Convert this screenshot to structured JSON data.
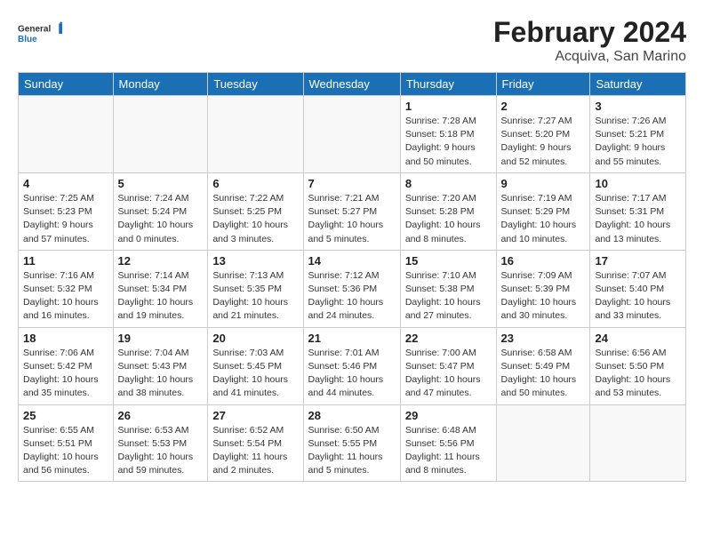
{
  "logo": {
    "general": "General",
    "blue": "Blue"
  },
  "title": "February 2024",
  "subtitle": "Acquiva, San Marino",
  "headers": [
    "Sunday",
    "Monday",
    "Tuesday",
    "Wednesday",
    "Thursday",
    "Friday",
    "Saturday"
  ],
  "weeks": [
    [
      {
        "num": "",
        "info": ""
      },
      {
        "num": "",
        "info": ""
      },
      {
        "num": "",
        "info": ""
      },
      {
        "num": "",
        "info": ""
      },
      {
        "num": "1",
        "info": "Sunrise: 7:28 AM\nSunset: 5:18 PM\nDaylight: 9 hours\nand 50 minutes."
      },
      {
        "num": "2",
        "info": "Sunrise: 7:27 AM\nSunset: 5:20 PM\nDaylight: 9 hours\nand 52 minutes."
      },
      {
        "num": "3",
        "info": "Sunrise: 7:26 AM\nSunset: 5:21 PM\nDaylight: 9 hours\nand 55 minutes."
      }
    ],
    [
      {
        "num": "4",
        "info": "Sunrise: 7:25 AM\nSunset: 5:23 PM\nDaylight: 9 hours\nand 57 minutes."
      },
      {
        "num": "5",
        "info": "Sunrise: 7:24 AM\nSunset: 5:24 PM\nDaylight: 10 hours\nand 0 minutes."
      },
      {
        "num": "6",
        "info": "Sunrise: 7:22 AM\nSunset: 5:25 PM\nDaylight: 10 hours\nand 3 minutes."
      },
      {
        "num": "7",
        "info": "Sunrise: 7:21 AM\nSunset: 5:27 PM\nDaylight: 10 hours\nand 5 minutes."
      },
      {
        "num": "8",
        "info": "Sunrise: 7:20 AM\nSunset: 5:28 PM\nDaylight: 10 hours\nand 8 minutes."
      },
      {
        "num": "9",
        "info": "Sunrise: 7:19 AM\nSunset: 5:29 PM\nDaylight: 10 hours\nand 10 minutes."
      },
      {
        "num": "10",
        "info": "Sunrise: 7:17 AM\nSunset: 5:31 PM\nDaylight: 10 hours\nand 13 minutes."
      }
    ],
    [
      {
        "num": "11",
        "info": "Sunrise: 7:16 AM\nSunset: 5:32 PM\nDaylight: 10 hours\nand 16 minutes."
      },
      {
        "num": "12",
        "info": "Sunrise: 7:14 AM\nSunset: 5:34 PM\nDaylight: 10 hours\nand 19 minutes."
      },
      {
        "num": "13",
        "info": "Sunrise: 7:13 AM\nSunset: 5:35 PM\nDaylight: 10 hours\nand 21 minutes."
      },
      {
        "num": "14",
        "info": "Sunrise: 7:12 AM\nSunset: 5:36 PM\nDaylight: 10 hours\nand 24 minutes."
      },
      {
        "num": "15",
        "info": "Sunrise: 7:10 AM\nSunset: 5:38 PM\nDaylight: 10 hours\nand 27 minutes."
      },
      {
        "num": "16",
        "info": "Sunrise: 7:09 AM\nSunset: 5:39 PM\nDaylight: 10 hours\nand 30 minutes."
      },
      {
        "num": "17",
        "info": "Sunrise: 7:07 AM\nSunset: 5:40 PM\nDaylight: 10 hours\nand 33 minutes."
      }
    ],
    [
      {
        "num": "18",
        "info": "Sunrise: 7:06 AM\nSunset: 5:42 PM\nDaylight: 10 hours\nand 35 minutes."
      },
      {
        "num": "19",
        "info": "Sunrise: 7:04 AM\nSunset: 5:43 PM\nDaylight: 10 hours\nand 38 minutes."
      },
      {
        "num": "20",
        "info": "Sunrise: 7:03 AM\nSunset: 5:45 PM\nDaylight: 10 hours\nand 41 minutes."
      },
      {
        "num": "21",
        "info": "Sunrise: 7:01 AM\nSunset: 5:46 PM\nDaylight: 10 hours\nand 44 minutes."
      },
      {
        "num": "22",
        "info": "Sunrise: 7:00 AM\nSunset: 5:47 PM\nDaylight: 10 hours\nand 47 minutes."
      },
      {
        "num": "23",
        "info": "Sunrise: 6:58 AM\nSunset: 5:49 PM\nDaylight: 10 hours\nand 50 minutes."
      },
      {
        "num": "24",
        "info": "Sunrise: 6:56 AM\nSunset: 5:50 PM\nDaylight: 10 hours\nand 53 minutes."
      }
    ],
    [
      {
        "num": "25",
        "info": "Sunrise: 6:55 AM\nSunset: 5:51 PM\nDaylight: 10 hours\nand 56 minutes."
      },
      {
        "num": "26",
        "info": "Sunrise: 6:53 AM\nSunset: 5:53 PM\nDaylight: 10 hours\nand 59 minutes."
      },
      {
        "num": "27",
        "info": "Sunrise: 6:52 AM\nSunset: 5:54 PM\nDaylight: 11 hours\nand 2 minutes."
      },
      {
        "num": "28",
        "info": "Sunrise: 6:50 AM\nSunset: 5:55 PM\nDaylight: 11 hours\nand 5 minutes."
      },
      {
        "num": "29",
        "info": "Sunrise: 6:48 AM\nSunset: 5:56 PM\nDaylight: 11 hours\nand 8 minutes."
      },
      {
        "num": "",
        "info": ""
      },
      {
        "num": "",
        "info": ""
      }
    ]
  ]
}
